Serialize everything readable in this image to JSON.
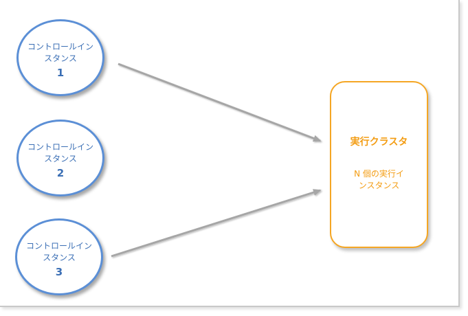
{
  "control_instances": [
    {
      "label": "コントロールインスタンス",
      "number": "1"
    },
    {
      "label": "コントロールインスタンス",
      "number": "2"
    },
    {
      "label": "コントロールインスタンス",
      "number": "3"
    }
  ],
  "cluster": {
    "title": "実行クラスタ",
    "description": "N 個の実行インスタンス"
  },
  "colors": {
    "circle_border": "#5b8fd6",
    "circle_text": "#3b6fb5",
    "cluster_border": "#f5a623",
    "cluster_text": "#f39c12",
    "arrow": "#a6a6a6"
  }
}
